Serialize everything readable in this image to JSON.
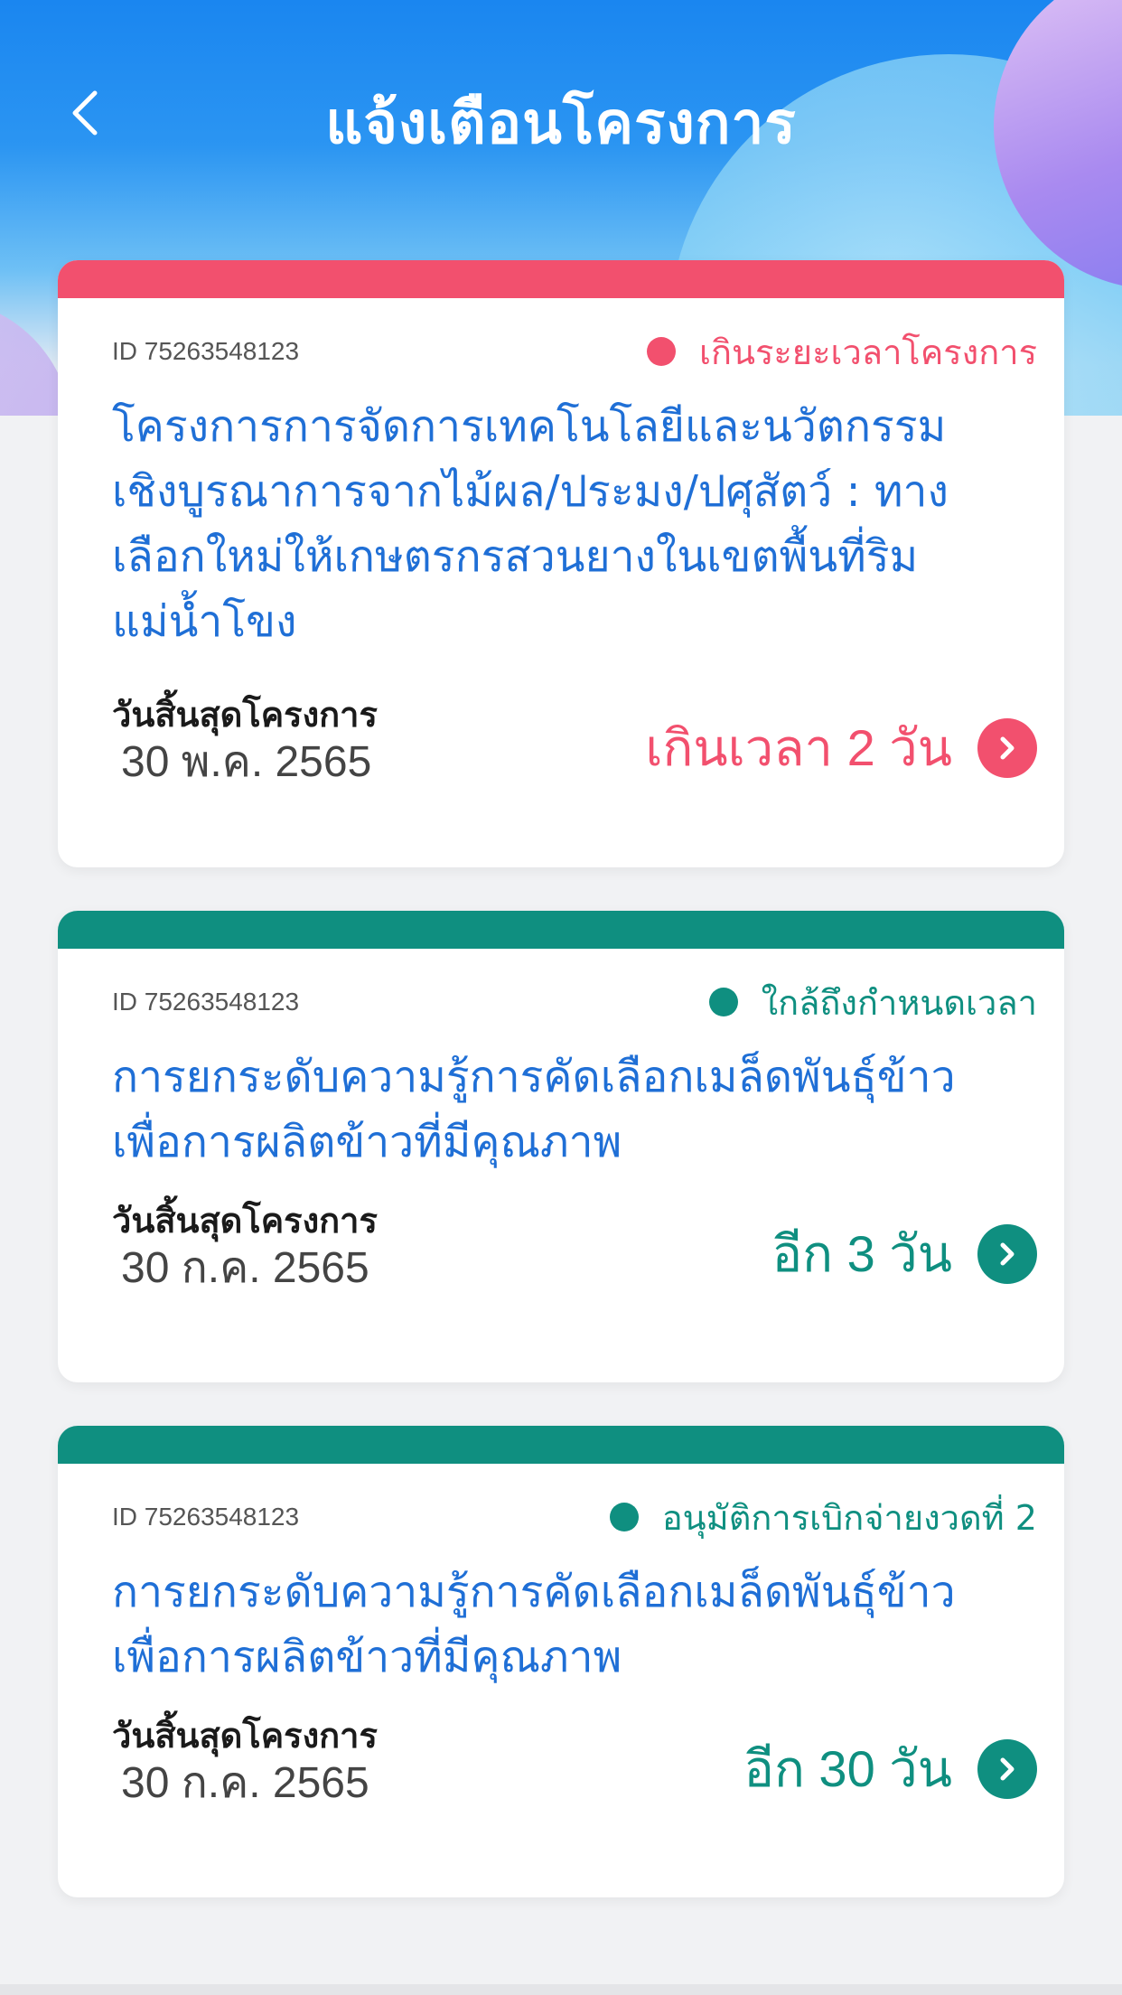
{
  "header": {
    "title": "แจ้งเตือนโครงการ"
  },
  "colors": {
    "overdue": "#f2506e",
    "upcoming": "#0f8f80",
    "title_blue": "#1f6fd6"
  },
  "cards": [
    {
      "id": "ID 75263548123",
      "status": "เกินระยะเวลาโครงการ",
      "status_type": "overdue",
      "title": "โครงการการจัดการเทคโนโลยีและนวัตกรรมเชิงบูรณาการจากไม้ผล/ประมง/ปศุสัตว์ : ทางเลือกใหม่ให้เกษตรกรสวนยางในเขตพื้นที่ริมแม่น้ำโขง",
      "deadline_label": "วันสิ้นสุดโครงการ",
      "deadline_date": "30 พ.ค. 2565",
      "remaining": "เกินเวลา 2 วัน"
    },
    {
      "id": "ID 75263548123",
      "status": "ใกล้ถึงกำหนดเวลา",
      "status_type": "upcoming",
      "title": "การยกระดับความรู้การคัดเลือกเมล็ดพันธุ์ข้าวเพื่อการผลิตข้าวที่มีคุณภาพ",
      "deadline_label": "วันสิ้นสุดโครงการ",
      "deadline_date": "30 ก.ค. 2565",
      "remaining": "อีก 3 วัน"
    },
    {
      "id": "ID 75263548123",
      "status": "อนุมัติการเบิกจ่ายงวดที่ 2",
      "status_type": "upcoming",
      "title": "การยกระดับความรู้การคัดเลือกเมล็ดพันธุ์ข้าวเพื่อการผลิตข้าวที่มีคุณภาพ",
      "deadline_label": "วันสิ้นสุดโครงการ",
      "deadline_date": "30 ก.ค. 2565",
      "remaining": "อีก 30 วัน"
    }
  ]
}
